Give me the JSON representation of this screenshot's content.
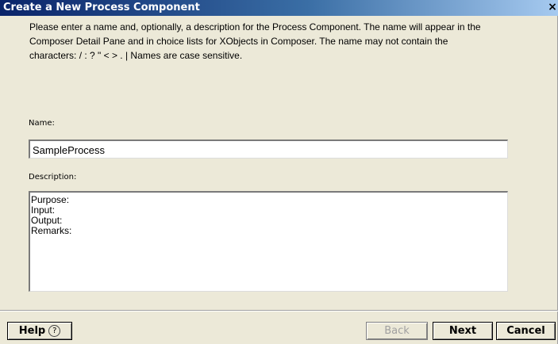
{
  "window": {
    "title": "Create a New Process Component",
    "close_glyph": "×"
  },
  "instructions": {
    "line1": "Please enter a name and, optionally, a description for the Process Component. The name will appear in the",
    "line2": "Composer Detail Pane and in choice lists for XObjects in Composer. The name may not contain the",
    "line3": "characters:  / : ? \" < > . |  Names are case sensitive."
  },
  "name_field": {
    "label": "Name:",
    "value": "SampleProcess"
  },
  "description_field": {
    "label": "Description:",
    "lines": [
      "Purpose:",
      "Input:",
      "Output:",
      "Remarks:"
    ]
  },
  "buttons": {
    "help_label": "Help",
    "help_icon": "question-circle-icon",
    "help_glyph": "?",
    "back_label": "Back",
    "next_label": "Next",
    "cancel_label": "Cancel"
  },
  "colors": {
    "titlebar_start": "#0a246a",
    "titlebar_end": "#a6caf0",
    "dialog_bg": "#ece9d8"
  }
}
